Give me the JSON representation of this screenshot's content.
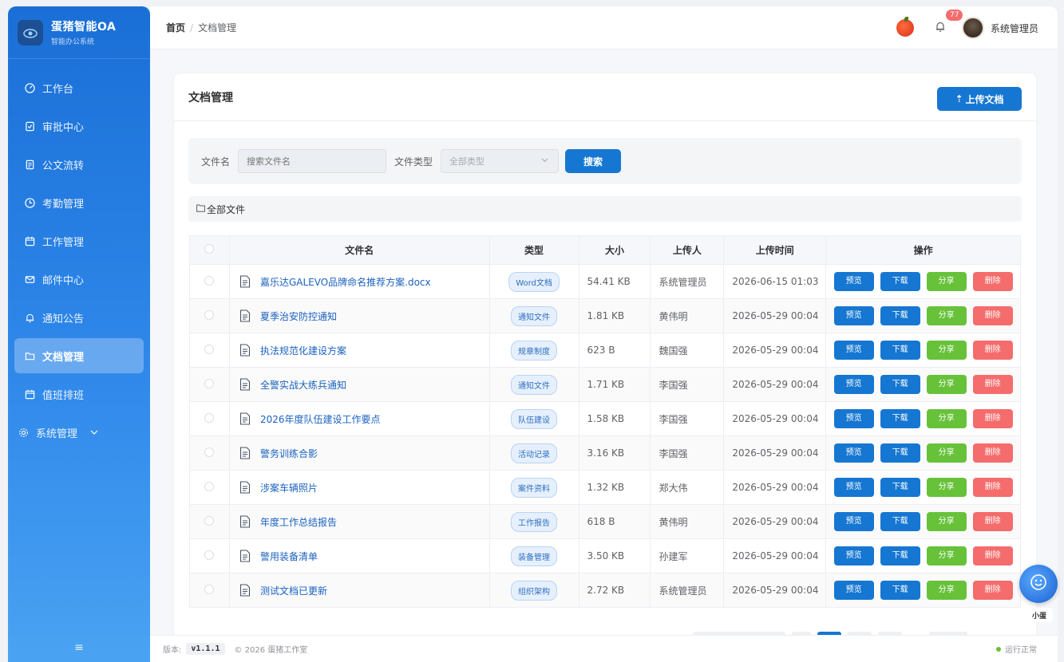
{
  "app": {
    "title": "蛋猪智能OA",
    "subtitle": "智能办公系统"
  },
  "sidebar": {
    "items": [
      {
        "label": "工作台",
        "icon": "gauge-icon"
      },
      {
        "label": "审批中心",
        "icon": "approval-icon"
      },
      {
        "label": "公文流转",
        "icon": "document-icon"
      },
      {
        "label": "考勤管理",
        "icon": "clock-icon"
      },
      {
        "label": "工作管理",
        "icon": "calendar-icon"
      },
      {
        "label": "邮件中心",
        "icon": "mail-icon"
      },
      {
        "label": "通知公告",
        "icon": "bell-icon"
      },
      {
        "label": "文档管理",
        "icon": "folder-icon",
        "active": true
      },
      {
        "label": "值班排班",
        "icon": "calendar-icon"
      },
      {
        "label": "系统管理",
        "icon": "gear-icon"
      }
    ],
    "collapse_glyph": "≡"
  },
  "header": {
    "breadcrumb_home": "首页",
    "breadcrumb_sep": "/",
    "breadcrumb_current": "文档管理",
    "notification_count": "77",
    "username": "系统管理员"
  },
  "page": {
    "title": "文档管理",
    "upload_label": "上传文档",
    "filter": {
      "filename_label": "文件名",
      "filename_placeholder": "搜索文件名",
      "type_label": "文件类型",
      "type_value": "全部类型",
      "search_label": "搜索"
    },
    "folder_label": "全部文件"
  },
  "table": {
    "headers": [
      "文件名",
      "类型",
      "大小",
      "上传人",
      "上传时间",
      "操作"
    ],
    "actions": [
      "预览",
      "下载",
      "分享",
      "删除"
    ],
    "rows": [
      {
        "name": "嘉乐达GALEVO品牌命名推荐方案.docx",
        "type": "Word文档",
        "size": "54.41 KB",
        "uploader": "系统管理员",
        "time": "2026-06-15 01:03"
      },
      {
        "name": "夏季治安防控通知",
        "type": "通知文件",
        "size": "1.81 KB",
        "uploader": "黄伟明",
        "time": "2026-05-29 00:04"
      },
      {
        "name": "执法规范化建设方案",
        "type": "规章制度",
        "size": "623 B",
        "uploader": "魏国强",
        "time": "2026-05-29 00:04"
      },
      {
        "name": "全警实战大练兵通知",
        "type": "通知文件",
        "size": "1.71 KB",
        "uploader": "李国强",
        "time": "2026-05-29 00:04"
      },
      {
        "name": "2026年度队伍建设工作要点",
        "type": "队伍建设",
        "size": "1.58 KB",
        "uploader": "李国强",
        "time": "2026-05-29 00:04"
      },
      {
        "name": "警务训练合影",
        "type": "活动记录",
        "size": "3.16 KB",
        "uploader": "李国强",
        "time": "2026-05-29 00:04"
      },
      {
        "name": "涉案车辆照片",
        "type": "案件资料",
        "size": "1.32 KB",
        "uploader": "郑大伟",
        "time": "2026-05-29 00:04"
      },
      {
        "name": "年度工作总结报告",
        "type": "工作报告",
        "size": "618 B",
        "uploader": "黄伟明",
        "time": "2026-05-29 00:04"
      },
      {
        "name": "警用装备清单",
        "type": "装备管理",
        "size": "3.50 KB",
        "uploader": "孙建军",
        "time": "2026-05-29 00:04"
      },
      {
        "name": "测试文档已更新",
        "type": "组织架构",
        "size": "2.72 KB",
        "uploader": "系统管理员",
        "time": "2026-05-29 00:04"
      }
    ]
  },
  "footer": {
    "version_label": "版本:",
    "version": "v1.1.1",
    "copyright": "© 2026 蛋猪工作室",
    "status": "运行正常"
  },
  "assistant": {
    "label": "小蛋"
  },
  "colors": {
    "primary": "#1677d2",
    "success": "#67c23a",
    "danger": "#f56c6c",
    "sidebar": "#2f88ea"
  }
}
